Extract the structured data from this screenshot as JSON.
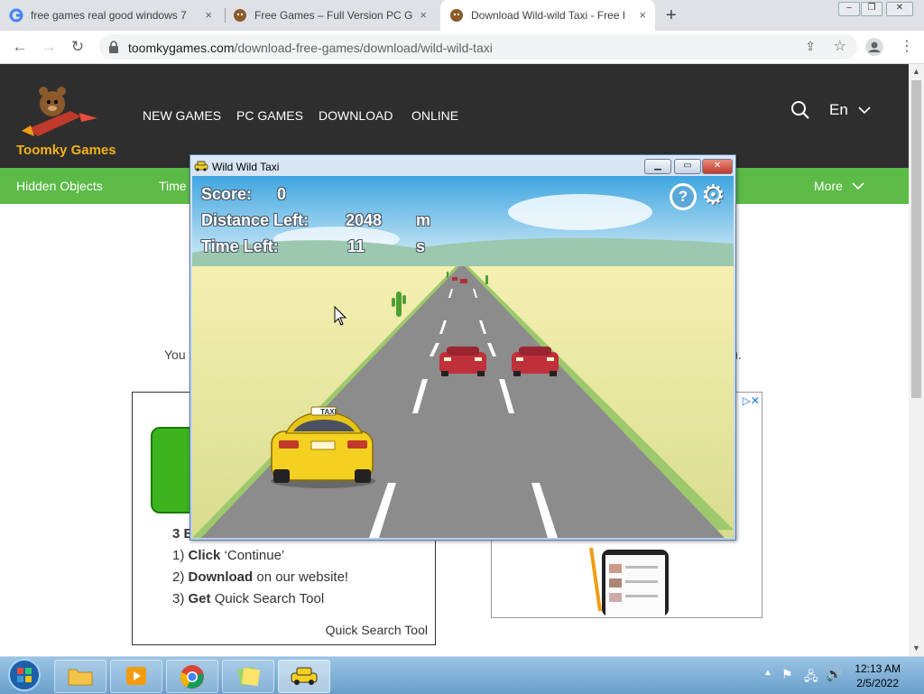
{
  "tabs": [
    {
      "title": "free games real good windows 7",
      "close": "×"
    },
    {
      "title": "Free Games – Full Version PC Gam",
      "close": "×"
    },
    {
      "title": "Download Wild-wild Taxi - Free P",
      "close": "×"
    }
  ],
  "new_tab": "+",
  "window_controls": {
    "minimize": "–",
    "maximize": "❐",
    "close": "✕"
  },
  "address": {
    "domain": "toomkygames.com",
    "path": "/download-free-games/download/wild-wild-taxi"
  },
  "site": {
    "brand": "Toomky Games",
    "nav": [
      "NEW GAMES",
      "PC GAMES",
      "DOWNLOAD",
      "ONLINE"
    ],
    "language": "En",
    "categories": {
      "first": "Hidden Objects",
      "second": "Time",
      "more": "More"
    },
    "body_left": "You",
    "body_right": "u.",
    "ad_left": {
      "heading": "3 E",
      "lines": [
        {
          "bold": "Click",
          "rest": " ‘Continue’"
        },
        {
          "bold": "Download",
          "rest": " on our website!"
        },
        {
          "bold": "Get",
          "rest": " Quick Search Tool"
        }
      ],
      "line_prefixes": [
        "1) ",
        "2) ",
        "3) "
      ],
      "footer": "Quick Search Tool"
    }
  },
  "game": {
    "window_title": "Wild Wild Taxi",
    "hud": {
      "score_label": "Score:",
      "score": "0",
      "distance_label": "Distance Left:",
      "distance": "2048",
      "distance_unit": "m",
      "time_label": "Time Left:",
      "time": "11",
      "time_unit": "s"
    },
    "taxi_sign": "TAXI",
    "help_icon": "?",
    "settings_icon": "⚙"
  },
  "taskbar": {
    "time": "12:13 AM",
    "date": "2/5/2022"
  },
  "colors": {
    "site_header": "#2e2e2e",
    "green_bar": "#5cba47",
    "brand": "#f5b21a",
    "taxi": "#f4d020"
  }
}
